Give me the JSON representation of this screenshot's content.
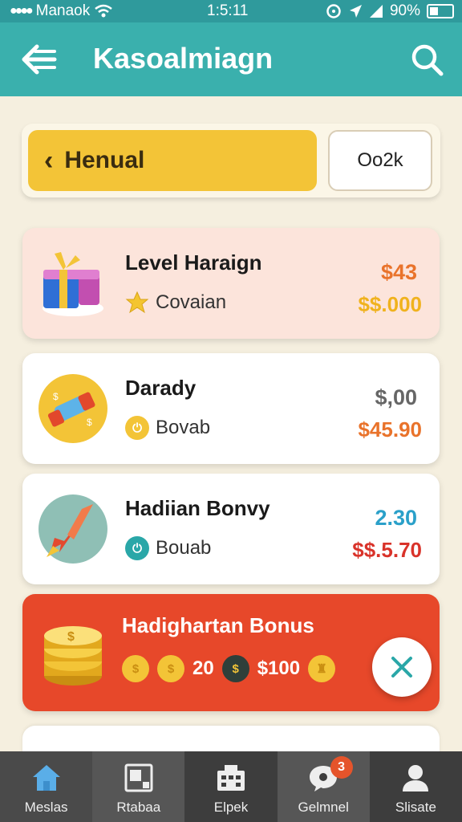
{
  "status_bar": {
    "carrier": "Manaok",
    "time": "1:5:11",
    "battery": "90%"
  },
  "header": {
    "title": "Kasoalmiagn"
  },
  "selector": {
    "main_label": "Henual",
    "side_label": "Oo2k"
  },
  "cards": [
    {
      "name": "Level Haraign",
      "sub_label": "Covaian",
      "value_top": "$43",
      "value_bottom": "$$.000"
    },
    {
      "name": "Darady",
      "sub_label": "Bovab",
      "value_top": "$,00",
      "value_bottom": "$45.90"
    },
    {
      "name": "Hadiian Bonvy",
      "sub_label": "Bouab",
      "value_top": "2.30",
      "value_bottom": "$$.5.70"
    }
  ],
  "bonus": {
    "title": "Hadighartan Bonus",
    "amount_a": "20",
    "amount_b": "$100"
  },
  "nav": {
    "items": [
      {
        "label": "Meslas"
      },
      {
        "label": "Rtabaa"
      },
      {
        "label": "Elpek"
      },
      {
        "label": "Gelmnel",
        "badge": "3"
      },
      {
        "label": "Slisate"
      }
    ]
  },
  "colors": {
    "teal": "#3ab0ad",
    "yellow": "#f3c437",
    "bonus_red": "#e7482a",
    "nav": "#3d3d3d"
  }
}
